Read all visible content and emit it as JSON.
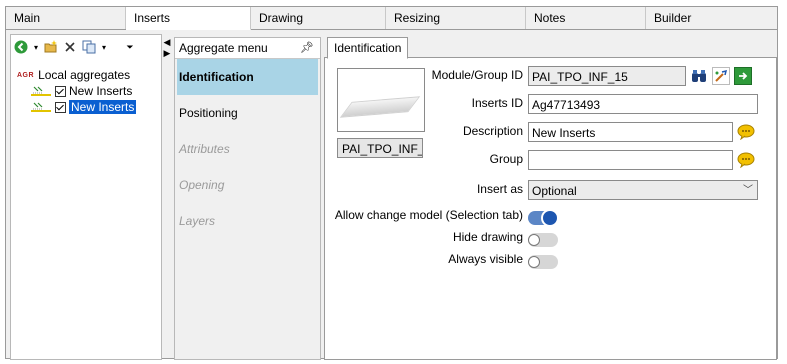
{
  "tabs": [
    "Main",
    "Inserts",
    "Drawing",
    "Resizing",
    "Notes",
    "Builder"
  ],
  "active_tab": "Inserts",
  "tree": {
    "root_badge": "AGR",
    "root_label": "Local aggregates",
    "items": [
      {
        "label": "New Inserts",
        "checked": true,
        "selected": false
      },
      {
        "label": "New Inserts",
        "checked": true,
        "selected": true
      }
    ]
  },
  "menu": {
    "title": "Aggregate menu",
    "items": [
      {
        "label": "Identification",
        "state": "active"
      },
      {
        "label": "Positioning",
        "state": "normal"
      },
      {
        "label": "Attributes",
        "state": "disabled"
      },
      {
        "label": "Opening",
        "state": "disabled"
      },
      {
        "label": "Layers",
        "state": "disabled"
      }
    ]
  },
  "identification": {
    "tab_label": "Identification",
    "preview_button": "PAI_TPO_INF_",
    "module_group_id": {
      "label": "Module/Group ID",
      "value": "PAI_TPO_INF_15"
    },
    "inserts_id": {
      "label": "Inserts ID",
      "value": "Ag47713493"
    },
    "description": {
      "label": "Description",
      "value": "New Inserts"
    },
    "group": {
      "label": "Group",
      "value": ""
    },
    "insert_as": {
      "label": "Insert as",
      "value": "Optional"
    },
    "allow_change_model": {
      "label": "Allow change model (Selection tab)",
      "on": true
    },
    "hide_drawing": {
      "label": "Hide drawing",
      "on": false
    },
    "always_visible": {
      "label": "Always visible",
      "on": false
    }
  },
  "colors": {
    "accent": "#1d56b0",
    "menu_active": "#a9d4e6",
    "selection": "#0a5fd1"
  }
}
